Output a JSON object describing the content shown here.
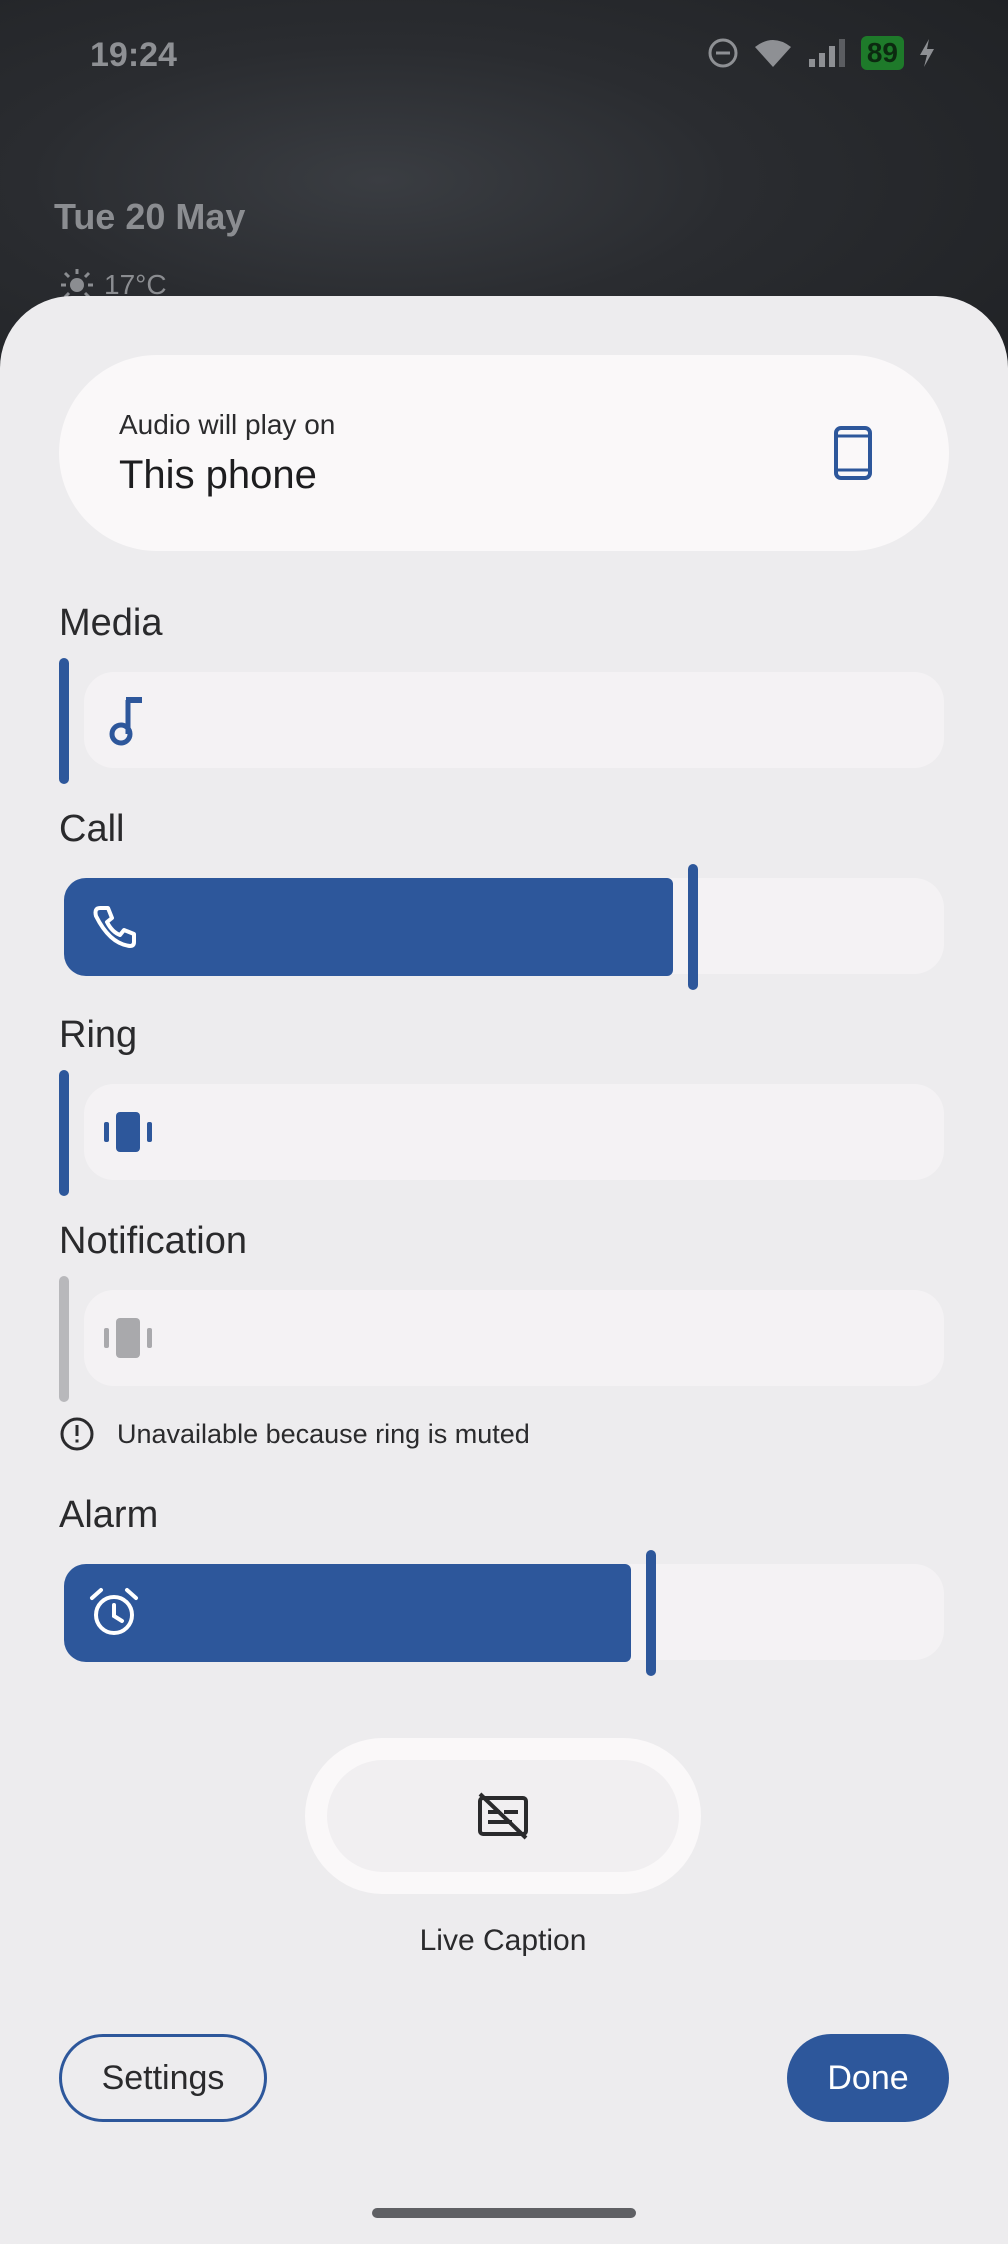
{
  "status_bar": {
    "time": "19:24",
    "battery": "89"
  },
  "lockscreen": {
    "date": "Tue 20 May",
    "temperature": "17°C"
  },
  "output": {
    "subtitle": "Audio will play on",
    "device": "This phone"
  },
  "volumes": {
    "media": {
      "label": "Media",
      "level": 0.0
    },
    "call": {
      "label": "Call",
      "level": 0.7
    },
    "ring": {
      "label": "Ring",
      "level": 0.0
    },
    "notification": {
      "label": "Notification",
      "level": 0.0,
      "enabled": false
    },
    "alarm": {
      "label": "Alarm",
      "level": 0.65
    }
  },
  "notice": {
    "text": "Unavailable because ring is muted"
  },
  "live_caption": {
    "label": "Live Caption"
  },
  "buttons": {
    "settings": "Settings",
    "done": "Done"
  },
  "colors": {
    "accent": "#2d579b",
    "sheet": "#edecee",
    "disabled": "#b8b8bb"
  }
}
